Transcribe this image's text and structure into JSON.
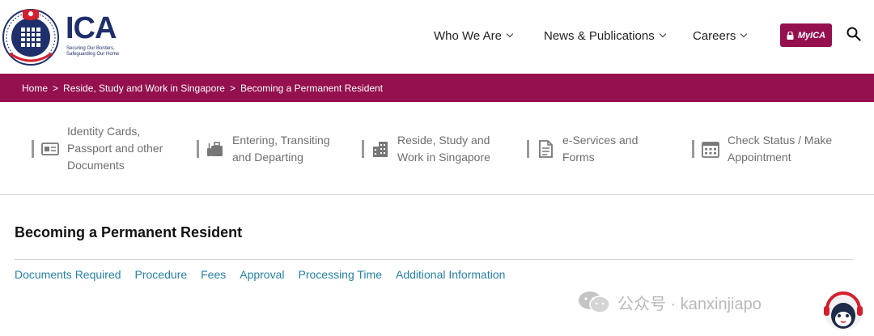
{
  "header": {
    "brand": "ICA",
    "tagline_line1": "Securing Our Borders,",
    "tagline_line2": "Safeguarding Our Home",
    "nav": [
      {
        "label": "Who We Are"
      },
      {
        "label": "News & Publications"
      },
      {
        "label": "Careers"
      }
    ],
    "myica_label": "MyICA"
  },
  "breadcrumb": {
    "items": [
      "Home",
      "Reside, Study and Work in Singapore",
      "Becoming a Permanent Resident"
    ],
    "separator": ">"
  },
  "categories": [
    {
      "line1": "Identity Cards,",
      "line2": "Passport and other",
      "line3": "Documents",
      "icon": "id-card-icon"
    },
    {
      "line1": "Entering, Transiting",
      "line2": "and Departing",
      "icon": "luggage-icon"
    },
    {
      "line1": "Reside, Study and",
      "line2": "Work in Singapore",
      "icon": "building-icon"
    },
    {
      "line1": "e-Services and",
      "line2": "Forms",
      "icon": "document-icon"
    },
    {
      "line1": "Check Status / Make",
      "line2": "Appointment",
      "icon": "calendar-icon"
    }
  ],
  "main": {
    "title": "Becoming a Permanent Resident",
    "tabs": [
      "Documents Required",
      "Procedure",
      "Fees",
      "Approval",
      "Processing Time",
      "Additional Information"
    ]
  },
  "watermark": {
    "text": "公众号 · kanxinjiapo"
  },
  "colors": {
    "brand": "#94104f",
    "navy": "#1f2f6b",
    "link": "#2580a8"
  }
}
